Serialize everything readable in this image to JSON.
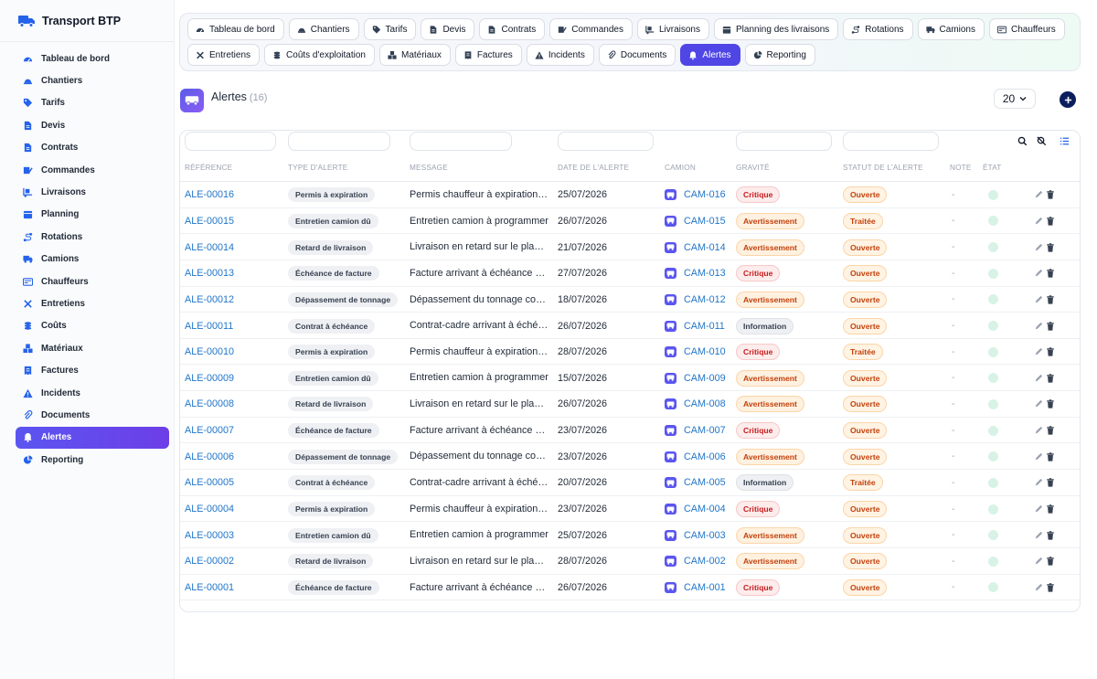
{
  "app": {
    "title": "Transport BTP"
  },
  "sidebar": {
    "items": [
      {
        "label": "Tableau de bord",
        "icon": "gauge-icon",
        "name": "tableau-de-bord"
      },
      {
        "label": "Chantiers",
        "icon": "hardhat-icon",
        "name": "chantiers"
      },
      {
        "label": "Tarifs",
        "icon": "tag-icon",
        "name": "tarifs"
      },
      {
        "label": "Devis",
        "icon": "document-icon",
        "name": "devis"
      },
      {
        "label": "Contrats",
        "icon": "document-icon",
        "name": "contrats"
      },
      {
        "label": "Commandes",
        "icon": "order-icon",
        "name": "commandes"
      },
      {
        "label": "Livraisons",
        "icon": "dolly-icon",
        "name": "livraisons"
      },
      {
        "label": "Planning",
        "icon": "calendar-icon",
        "name": "planning"
      },
      {
        "label": "Rotations",
        "icon": "route-icon",
        "name": "rotations"
      },
      {
        "label": "Camions",
        "icon": "truck-icon",
        "name": "camions"
      },
      {
        "label": "Chauffeurs",
        "icon": "id-card-icon",
        "name": "chauffeurs"
      },
      {
        "label": "Entretiens",
        "icon": "tools-icon",
        "name": "entretiens"
      },
      {
        "label": "Coûts",
        "icon": "coins-icon",
        "name": "couts"
      },
      {
        "label": "Matériaux",
        "icon": "cubes-icon",
        "name": "materiaux"
      },
      {
        "label": "Factures",
        "icon": "invoice-icon",
        "name": "factures"
      },
      {
        "label": "Incidents",
        "icon": "warning-icon",
        "name": "incidents"
      },
      {
        "label": "Documents",
        "icon": "paperclip-icon",
        "name": "documents"
      },
      {
        "label": "Alertes",
        "icon": "bell-icon",
        "name": "alertes",
        "active": true
      },
      {
        "label": "Reporting",
        "icon": "pie-chart-icon",
        "name": "reporting"
      }
    ]
  },
  "tabs": [
    {
      "label": "Tableau de bord",
      "icon": "gauge-icon",
      "name": "tableau-de-bord"
    },
    {
      "label": "Chantiers",
      "icon": "hardhat-icon",
      "name": "chantiers"
    },
    {
      "label": "Tarifs",
      "icon": "tag-icon",
      "name": "tarifs"
    },
    {
      "label": "Devis",
      "icon": "document-icon",
      "name": "devis"
    },
    {
      "label": "Contrats",
      "icon": "document-icon",
      "name": "contrats"
    },
    {
      "label": "Commandes",
      "icon": "order-icon",
      "name": "commandes"
    },
    {
      "label": "Livraisons",
      "icon": "dolly-icon",
      "name": "livraisons"
    },
    {
      "label": "Planning des livraisons",
      "icon": "calendar-icon",
      "name": "planning-des-livraisons"
    },
    {
      "label": "Rotations",
      "icon": "route-icon",
      "name": "rotations"
    },
    {
      "label": "Camions",
      "icon": "truck-icon",
      "name": "camions"
    },
    {
      "label": "Chauffeurs",
      "icon": "id-card-icon",
      "name": "chauffeurs"
    },
    {
      "label": "Entretiens",
      "icon": "tools-icon",
      "name": "entretiens"
    },
    {
      "label": "Coûts d'exploitation",
      "icon": "coins-icon",
      "name": "couts-exploitation"
    },
    {
      "label": "Matériaux",
      "icon": "cubes-icon",
      "name": "materiaux"
    },
    {
      "label": "Factures",
      "icon": "invoice-icon",
      "name": "factures"
    },
    {
      "label": "Incidents",
      "icon": "warning-icon",
      "name": "incidents"
    },
    {
      "label": "Documents",
      "icon": "paperclip-icon",
      "name": "documents"
    },
    {
      "label": "Alertes",
      "icon": "bell-icon",
      "name": "alertes",
      "active": true
    },
    {
      "label": "Reporting",
      "icon": "pie-chart-icon",
      "name": "reporting"
    }
  ],
  "page": {
    "title": "Alertes",
    "count": "(16)",
    "per_page": "20"
  },
  "table": {
    "columns": [
      "Référence",
      "Type d'alerte",
      "Message",
      "Date de l'alerte",
      "Camion",
      "Gravité",
      "Statut de l'alerte",
      "Note",
      "État"
    ],
    "rows": [
      {
        "ref": "ALE-00016",
        "type": "Permis à expiration",
        "message": "Permis chauffeur à expiration prochaine",
        "date": "25/07/2026",
        "camion": "CAM-016",
        "gravite": "Critique",
        "statut": "Ouverte",
        "note": "-"
      },
      {
        "ref": "ALE-00015",
        "type": "Entretien camion dû",
        "message": "Entretien camion à programmer",
        "date": "26/07/2026",
        "camion": "CAM-015",
        "gravite": "Avertissement",
        "statut": "Traitée",
        "note": "-"
      },
      {
        "ref": "ALE-00014",
        "type": "Retard de livraison",
        "message": "Livraison en retard sur le planning",
        "date": "21/07/2026",
        "camion": "CAM-014",
        "gravite": "Avertissement",
        "statut": "Ouverte",
        "note": "-"
      },
      {
        "ref": "ALE-00013",
        "type": "Échéance de facture",
        "message": "Facture arrivant à échéance sous peu",
        "date": "27/07/2026",
        "camion": "CAM-013",
        "gravite": "Critique",
        "statut": "Ouverte",
        "note": "-"
      },
      {
        "ref": "ALE-00012",
        "type": "Dépassement de tonnage",
        "message": "Dépassement du tonnage contractuel",
        "date": "18/07/2026",
        "camion": "CAM-012",
        "gravite": "Avertissement",
        "statut": "Ouverte",
        "note": "-"
      },
      {
        "ref": "ALE-00011",
        "type": "Contrat à échéance",
        "message": "Contrat-cadre arrivant à échéance",
        "date": "26/07/2026",
        "camion": "CAM-011",
        "gravite": "Information",
        "statut": "Ouverte",
        "note": "-"
      },
      {
        "ref": "ALE-00010",
        "type": "Permis à expiration",
        "message": "Permis chauffeur à expiration prochaine",
        "date": "28/07/2026",
        "camion": "CAM-010",
        "gravite": "Critique",
        "statut": "Traitée",
        "note": "-"
      },
      {
        "ref": "ALE-00009",
        "type": "Entretien camion dû",
        "message": "Entretien camion à programmer",
        "date": "15/07/2026",
        "camion": "CAM-009",
        "gravite": "Avertissement",
        "statut": "Ouverte",
        "note": "-"
      },
      {
        "ref": "ALE-00008",
        "type": "Retard de livraison",
        "message": "Livraison en retard sur le planning",
        "date": "26/07/2026",
        "camion": "CAM-008",
        "gravite": "Avertissement",
        "statut": "Ouverte",
        "note": "-"
      },
      {
        "ref": "ALE-00007",
        "type": "Échéance de facture",
        "message": "Facture arrivant à échéance sous peu",
        "date": "23/07/2026",
        "camion": "CAM-007",
        "gravite": "Critique",
        "statut": "Ouverte",
        "note": "-"
      },
      {
        "ref": "ALE-00006",
        "type": "Dépassement de tonnage",
        "message": "Dépassement du tonnage contractuel",
        "date": "23/07/2026",
        "camion": "CAM-006",
        "gravite": "Avertissement",
        "statut": "Ouverte",
        "note": "-"
      },
      {
        "ref": "ALE-00005",
        "type": "Contrat à échéance",
        "message": "Contrat-cadre arrivant à échéance",
        "date": "20/07/2026",
        "camion": "CAM-005",
        "gravite": "Information",
        "statut": "Traitée",
        "note": "-"
      },
      {
        "ref": "ALE-00004",
        "type": "Permis à expiration",
        "message": "Permis chauffeur à expiration prochaine",
        "date": "23/07/2026",
        "camion": "CAM-004",
        "gravite": "Critique",
        "statut": "Ouverte",
        "note": "-"
      },
      {
        "ref": "ALE-00003",
        "type": "Entretien camion dû",
        "message": "Entretien camion à programmer",
        "date": "25/07/2026",
        "camion": "CAM-003",
        "gravite": "Avertissement",
        "statut": "Ouverte",
        "note": "-"
      },
      {
        "ref": "ALE-00002",
        "type": "Retard de livraison",
        "message": "Livraison en retard sur le planning",
        "date": "28/07/2026",
        "camion": "CAM-002",
        "gravite": "Avertissement",
        "statut": "Ouverte",
        "note": "-"
      },
      {
        "ref": "ALE-00001",
        "type": "Échéance de facture",
        "message": "Facture arrivant à échéance sous peu",
        "date": "26/07/2026",
        "camion": "CAM-001",
        "gravite": "Critique",
        "statut": "Ouverte",
        "note": "-"
      }
    ]
  },
  "colors": {
    "accent": "#4f46e5",
    "link": "#2176c9",
    "add_button": "#0c1f5c"
  }
}
